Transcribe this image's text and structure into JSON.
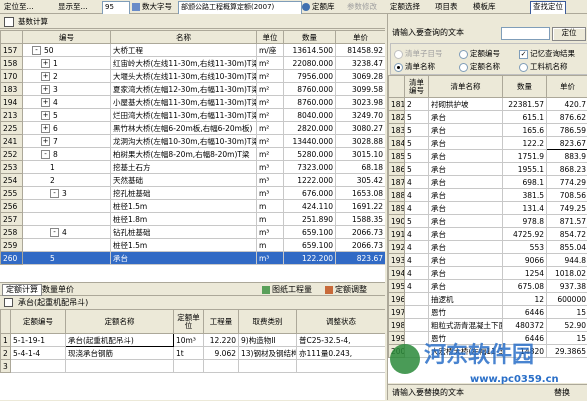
{
  "toolbar": {
    "items": [
      "定位至...",
      "显示至...",
      "数大字号",
      "部颁公路工程概算定额(2007)",
      "定额库",
      "参数修改",
      "定额选择",
      "项目表",
      "模板库",
      "查找定位"
    ],
    "scale_value": "95"
  },
  "upper": {
    "tab_label": "基数计算",
    "columns": [
      "编号",
      "名称",
      "单位",
      "数量",
      "单价"
    ],
    "rows": [
      {
        "rn": "157",
        "code": "50",
        "name": "大桥工程",
        "unit": "m/座",
        "qty": "13614.500",
        "price": "81458.92",
        "lvl": 1,
        "tree": "-"
      },
      {
        "rn": "158",
        "code": "1",
        "name": "红宙岭大桥(左线11-30m,右线11-30m)T梁",
        "unit": "m²",
        "qty": "22080.000",
        "price": "3238.47",
        "lvl": 2,
        "tree": "+"
      },
      {
        "rn": "170",
        "code": "2",
        "name": "大堰头大桥(左线11-30m,右线10-30m)T梁",
        "unit": "m²",
        "qty": "7956.000",
        "price": "3069.28",
        "lvl": 2,
        "tree": "+"
      },
      {
        "rn": "183",
        "code": "3",
        "name": "夏家湾大桥(左幅12-30m,右幅11-30m)T梁",
        "unit": "m²",
        "qty": "8760.000",
        "price": "3099.58",
        "lvl": 2,
        "tree": "+"
      },
      {
        "rn": "194",
        "code": "4",
        "name": "小屋基大桥(左幅11-30m,右幅11-30m)T梁",
        "unit": "m²",
        "qty": "8760.000",
        "price": "3023.98",
        "lvl": 2,
        "tree": "+"
      },
      {
        "rn": "213",
        "code": "5",
        "name": "烂田湾大桥(左幅11-30m,右幅11-30m)T梁",
        "unit": "m²",
        "qty": "8040.000",
        "price": "3249.70",
        "lvl": 2,
        "tree": "+"
      },
      {
        "rn": "225",
        "code": "6",
        "name": "黑竹林大桥(左幅6-20m板,右幅6-20m板)",
        "unit": "m²",
        "qty": "2820.000",
        "price": "3080.27",
        "lvl": 2,
        "tree": "+"
      },
      {
        "rn": "241",
        "code": "7",
        "name": "龙洞沟大桥(左幅10-30m,右幅10-30m)T梁",
        "unit": "m²",
        "qty": "13440.000",
        "price": "3028.88",
        "lvl": 2,
        "tree": "+"
      },
      {
        "rn": "252",
        "code": "8",
        "name": "柏树果大桥(左幅8-20m,右幅8-20m)T梁",
        "unit": "m²",
        "qty": "5280.000",
        "price": "3015.10",
        "lvl": 2,
        "tree": "-"
      },
      {
        "rn": "253",
        "code": "1",
        "name": "挖基土石方",
        "unit": "m³",
        "qty": "7323.000",
        "price": "68.18",
        "lvl": 3,
        "tree": ""
      },
      {
        "rn": "254",
        "code": "2",
        "name": "天然基础",
        "unit": "m³",
        "qty": "1222.000",
        "price": "305.42",
        "lvl": 3,
        "tree": ""
      },
      {
        "rn": "255",
        "code": "3",
        "name": "挖孔桩基础",
        "unit": "m³",
        "qty": "676.000",
        "price": "1653.08",
        "lvl": 3,
        "tree": "-"
      },
      {
        "rn": "256",
        "code": "",
        "name": "桩径1.5m",
        "unit": "m",
        "qty": "424.110",
        "price": "1691.22",
        "lvl": 4,
        "tree": ""
      },
      {
        "rn": "257",
        "code": "",
        "name": "桩径1.8m",
        "unit": "m",
        "qty": "251.890",
        "price": "1588.35",
        "lvl": 4,
        "tree": ""
      },
      {
        "rn": "258",
        "code": "4",
        "name": "钻孔桩基础",
        "unit": "m³",
        "qty": "659.100",
        "price": "2066.73",
        "lvl": 3,
        "tree": "-"
      },
      {
        "rn": "259",
        "code": "",
        "name": "桩径1.5m",
        "unit": "m",
        "qty": "659.100",
        "price": "2066.73",
        "lvl": 4,
        "tree": ""
      },
      {
        "rn": "260",
        "code": "5",
        "name": "承台",
        "unit": "m³",
        "qty": "122.200",
        "price": "823.67",
        "lvl": 3,
        "tree": "",
        "sel": true
      }
    ]
  },
  "splitter": {
    "tabs": [
      "定额计算",
      "数量单价"
    ],
    "buttons": [
      "图纸工程量",
      "定额调整"
    ]
  },
  "lower": {
    "title": "承台(起重机配吊斗)",
    "columns": [
      "定额编号",
      "定额名称",
      "定额单位",
      "工程量",
      "取费类别",
      "调整状态"
    ],
    "rows": [
      {
        "rn": "1",
        "code": "5-1-19-1",
        "name": "承台(起重机配吊斗)",
        "unit": "10m³",
        "qty": "12.220",
        "fee": "9)构造物II",
        "adj": "普C25-32.5-4,"
      },
      {
        "rn": "2",
        "code": "5-4-1-4",
        "name": "现浇承台钢筋",
        "unit": "1t",
        "qty": "9.062",
        "fee": "13)钢材及钢结构",
        "adj": "亦111量0.243,"
      },
      {
        "rn": "3",
        "code": "",
        "name": "",
        "unit": "",
        "qty": "",
        "fee": "",
        "adj": ""
      }
    ]
  },
  "right": {
    "search_label": "请输入要查询的文本",
    "search_button": "定位",
    "options": [
      {
        "label": "清单子目号",
        "state": "disabled"
      },
      {
        "label": "定额编号",
        "state": "off"
      },
      {
        "label": "记忆查询结果",
        "state": "checked"
      },
      {
        "label": "清单名称",
        "state": "on"
      },
      {
        "label": "定额名称",
        "state": "off"
      },
      {
        "label": "工料机名称",
        "state": "off"
      }
    ],
    "columns": [
      "",
      "清单编号",
      "清单名称",
      "数量",
      "单价"
    ],
    "rows": [
      {
        "rn": "181",
        "code": "2",
        "name": "衬砌拱护坡",
        "qty": "22381.57",
        "price": "420.7"
      },
      {
        "rn": "182",
        "code": "5",
        "name": "承台",
        "qty": "615.1",
        "price": "876.62"
      },
      {
        "rn": "183",
        "code": "5",
        "name": "承台",
        "qty": "165.6",
        "price": "786.59"
      },
      {
        "rn": "184",
        "code": "5",
        "name": "承台",
        "qty": "122.2",
        "price": "823.67",
        "sel": true
      },
      {
        "rn": "185",
        "code": "5",
        "name": "承台",
        "qty": "1751.9",
        "price": "883.9"
      },
      {
        "rn": "186",
        "code": "5",
        "name": "承台",
        "qty": "1955.1",
        "price": "868.23"
      },
      {
        "rn": "187",
        "code": "4",
        "name": "承台",
        "qty": "698.1",
        "price": "774.29"
      },
      {
        "rn": "188",
        "code": "4",
        "name": "承台",
        "qty": "381.5",
        "price": "708.56"
      },
      {
        "rn": "189",
        "code": "4",
        "name": "承台",
        "qty": "131.4",
        "price": "749.25"
      },
      {
        "rn": "190",
        "code": "5",
        "name": "承台",
        "qty": "978.8",
        "price": "871.57"
      },
      {
        "rn": "191",
        "code": "4",
        "name": "承台",
        "qty": "4725.92",
        "price": "854.72"
      },
      {
        "rn": "192",
        "code": "4",
        "name": "承台",
        "qty": "553",
        "price": "855.04"
      },
      {
        "rn": "193",
        "code": "4",
        "name": "承台",
        "qty": "9066",
        "price": "944.8"
      },
      {
        "rn": "194",
        "code": "4",
        "name": "承台",
        "qty": "1254",
        "price": "1018.02"
      },
      {
        "rn": "195",
        "code": "4",
        "name": "承台",
        "qty": "675.08",
        "price": "937.38"
      },
      {
        "rn": "196",
        "code": "",
        "name": "抽逻机",
        "qty": "12",
        "price": "600000"
      },
      {
        "rn": "197",
        "code": "",
        "name": "恩竹",
        "qty": "6446",
        "price": "15"
      },
      {
        "rn": "198",
        "code": "",
        "name": "粗粒式沥青混凝土下面层",
        "qty": "480372",
        "price": "52.90"
      },
      {
        "rn": "199",
        "code": "",
        "name": "恩竹",
        "qty": "6446",
        "price": "15"
      },
      {
        "rn": "200",
        "code": "",
        "name": "大宏桥大桥(左幅11-30m,右线...",
        "qty": "14820",
        "price": "29.3865"
      }
    ],
    "bottom_tabs": [
      "请输入要替换的文本",
      "替换"
    ]
  },
  "watermark": {
    "line1": "河东软件园",
    "line2": "www.pc0359.cn"
  }
}
